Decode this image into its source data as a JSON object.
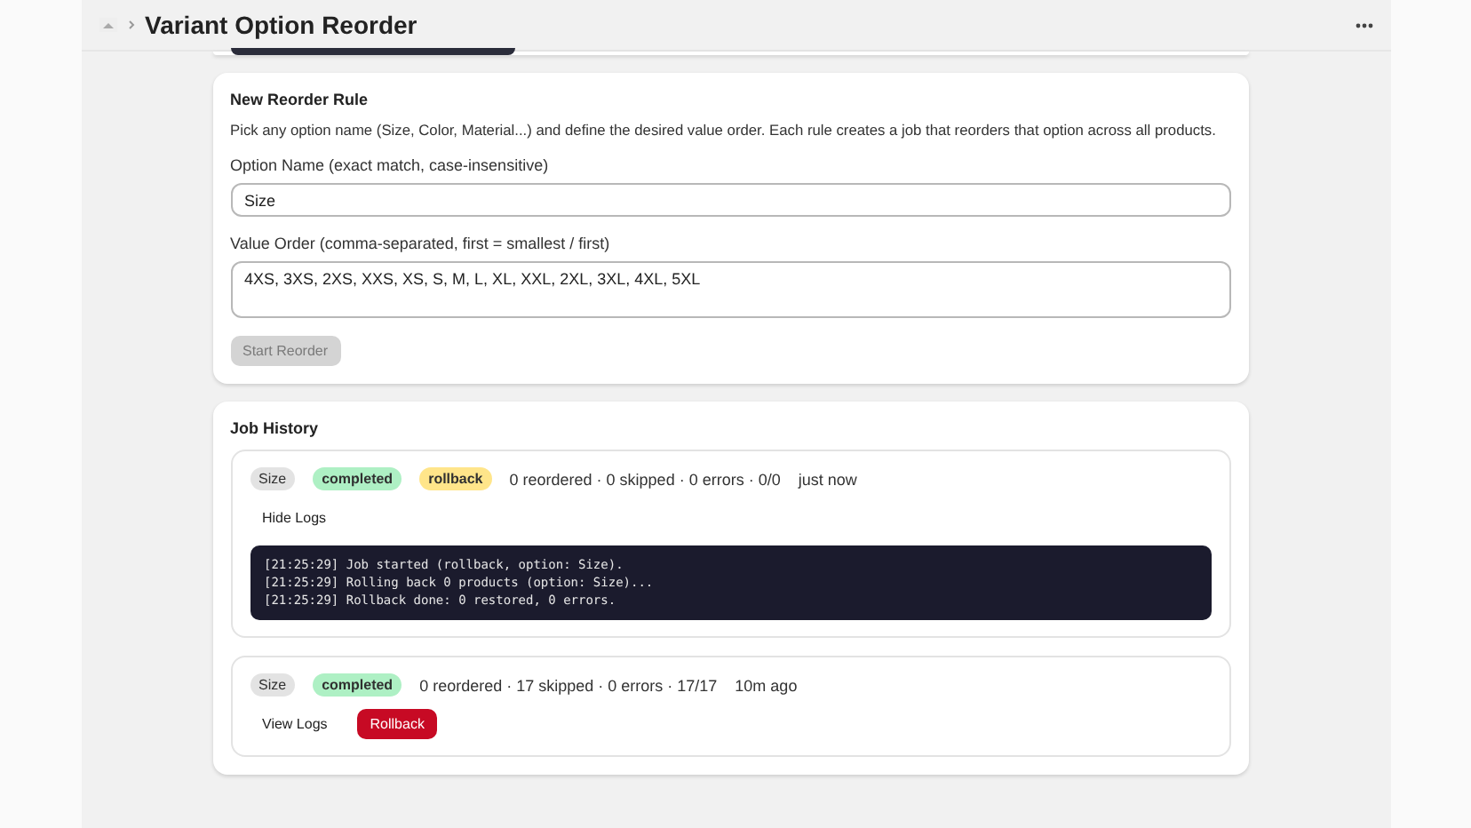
{
  "header": {
    "title": "Variant Option Reorder"
  },
  "rule_form": {
    "title": "New Reorder Rule",
    "description": "Pick any option name (Size, Color, Material...) and define the desired value order. Each rule creates a job that reorders that option across all products.",
    "option_label": "Option Name (exact match, case-insensitive)",
    "option_value": "Size",
    "order_label": "Value Order (comma-separated, first = smallest / first)",
    "order_value": "4XS, 3XS, 2XS, XXS, XS, S, M, L, XL, XXL, 2XL, 3XL, 4XL, 5XL",
    "submit": {
      "label": "Start Reorder",
      "disabled": true
    }
  },
  "job_history": {
    "title": "Job History",
    "jobs": [
      {
        "option": "Size",
        "status": "completed",
        "kind_badge": "rollback",
        "summary": "0 reordered · 0 skipped · 0 errors · 0/0",
        "time": "just now",
        "logs_toggle": "Hide Logs",
        "logs": [
          "[21:25:29] Job started (rollback, option: Size).",
          "[21:25:29] Rolling back 0 products (option: Size)...",
          "[21:25:29] Rollback done: 0 restored, 0 errors."
        ]
      },
      {
        "option": "Size",
        "status": "completed",
        "summary": "0 reordered · 17 skipped · 0 errors · 17/17",
        "time": "10m ago",
        "logs_toggle": "View Logs",
        "action": "Rollback"
      }
    ]
  }
}
